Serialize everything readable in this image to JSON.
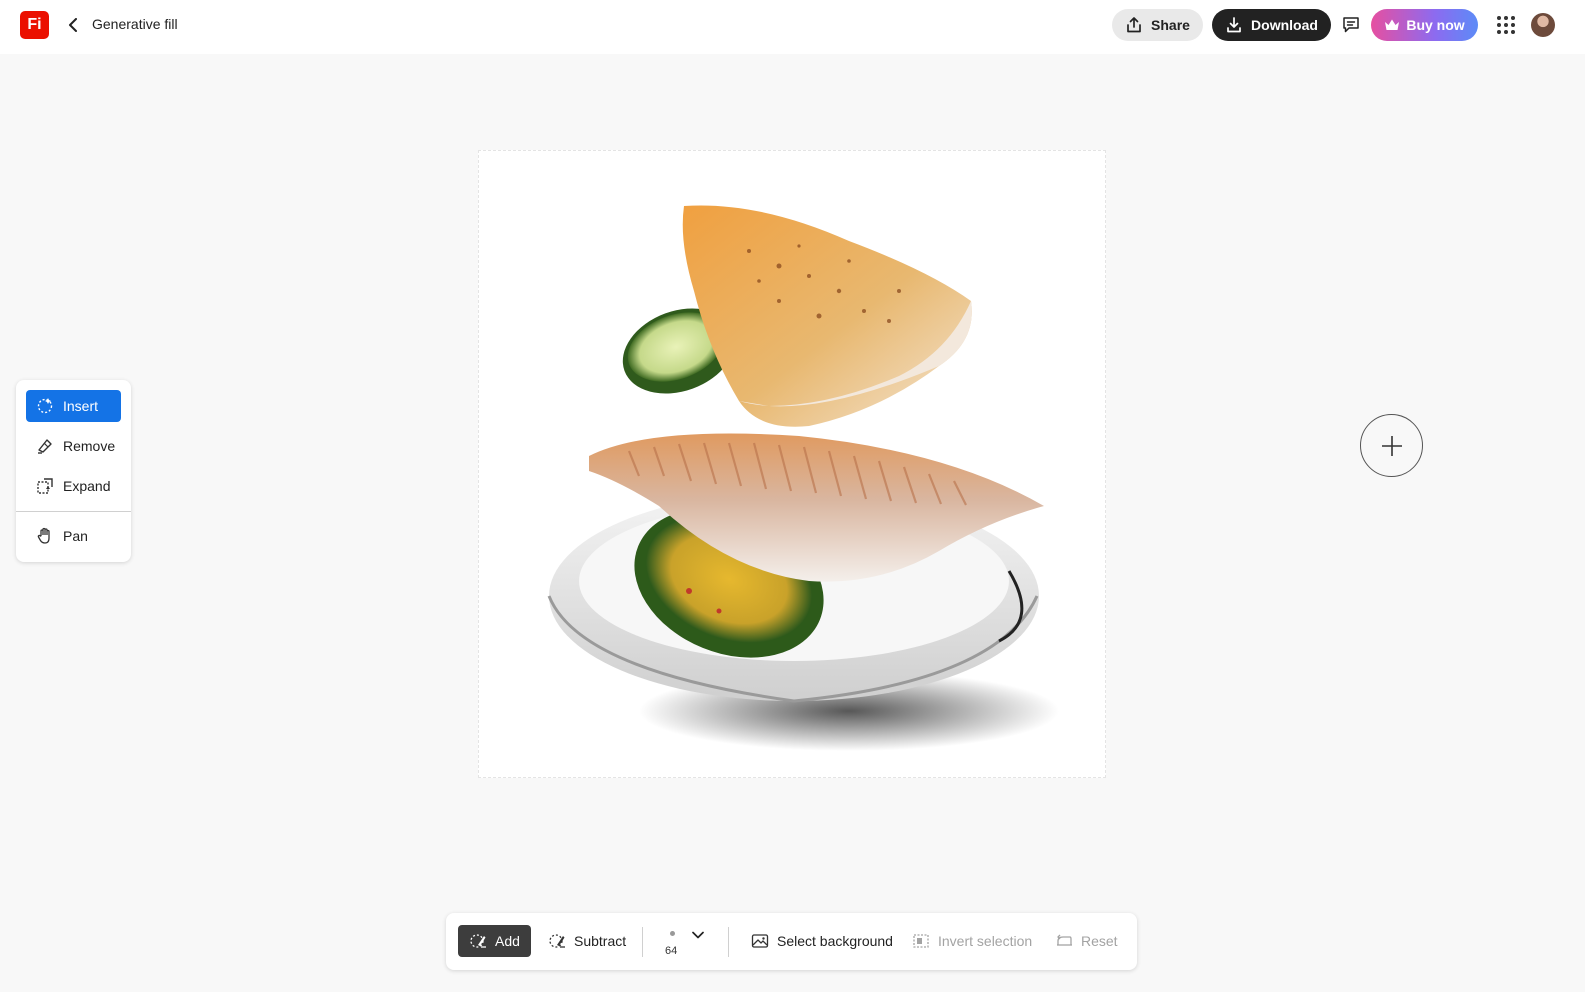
{
  "header": {
    "logo_text": "Fi",
    "back_icon": "chevron-left-icon",
    "title": "Generative fill",
    "share_label": "Share",
    "download_label": "Download",
    "buy_label": "Buy now"
  },
  "tools": {
    "items": [
      {
        "label": "Insert",
        "icon": "insert-icon",
        "active": true
      },
      {
        "label": "Remove",
        "icon": "remove-icon",
        "active": false
      },
      {
        "label": "Expand",
        "icon": "expand-icon",
        "active": false
      },
      {
        "label": "Pan",
        "icon": "hand-icon",
        "active": false
      }
    ]
  },
  "toolbar": {
    "add_label": "Add",
    "subtract_label": "Subtract",
    "brush_size": "64",
    "select_background_label": "Select background",
    "invert_selection_label": "Invert selection",
    "reset_label": "Reset"
  },
  "colors": {
    "accent": "#1473e6",
    "logo": "#eb1000",
    "download_bg": "#222222",
    "active_tool_bg": "#3d3d3d"
  }
}
